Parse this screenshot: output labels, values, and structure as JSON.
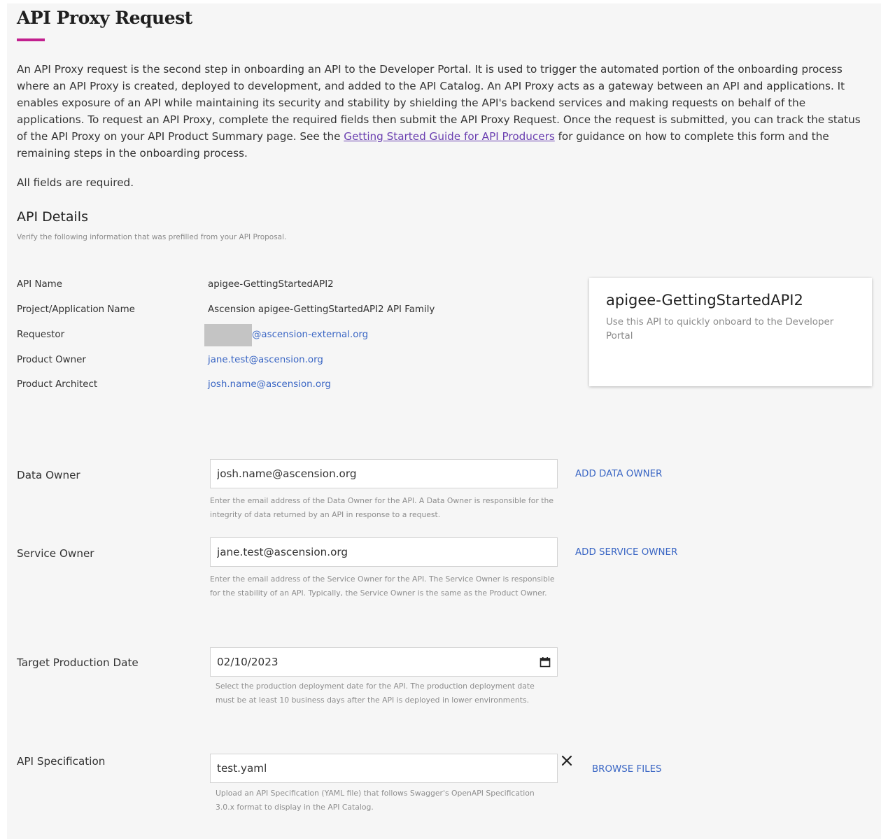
{
  "page": {
    "title": "API Proxy Request",
    "intro_before_link": "An API Proxy request is the second step in onboarding an API to the Developer Portal. It is used to trigger the automated portion of the onboarding process where an API Proxy is created, deployed to development, and added to the API Catalog. An API Proxy acts as a gateway between an API and applications. It enables exposure of an API while maintaining its security and stability by shielding the API's backend services and making requests on behalf of the applications. To request an API Proxy, complete the required fields then submit the API Proxy Request. Once the request is submitted, you can track the status of the API Proxy on your API Product Summary page. See the ",
    "intro_link": "Getting Started Guide for API Producers",
    "intro_after_link": " for guidance on how to complete this form and the remaining steps in the onboarding process.",
    "required_note": "All fields are required."
  },
  "details": {
    "title": "API Details",
    "subtitle": "Verify the following information that was prefilled from your API Proposal.",
    "rows": [
      {
        "label": "API Name",
        "value": "apigee-GettingStartedAPI2"
      },
      {
        "label": "Project/Application Name",
        "value": "Ascension apigee-GettingStartedAPI2 API Family"
      },
      {
        "label": "Requestor",
        "value": "@ascension-external.org"
      },
      {
        "label": "Product Owner",
        "value": "jane.test@ascension.org"
      },
      {
        "label": "Product Architect",
        "value": "josh.name@ascension.org"
      }
    ]
  },
  "card": {
    "title": "apigee-GettingStartedAPI2",
    "description": "Use this API to quickly onboard to the Developer Portal"
  },
  "form": {
    "data_owner": {
      "label": "Data Owner",
      "value": "josh.name@ascension.org",
      "help": "Enter the email address of the Data Owner for the API. A Data Owner is responsible for the integrity of data returned by an API in response to a request.",
      "action": "ADD DATA OWNER"
    },
    "service_owner": {
      "label": "Service Owner",
      "value": "jane.test@ascension.org",
      "help": "Enter the email address of the Service Owner for the API. The Service Owner is responsible for the stability of an API. Typically, the Service Owner is the same as the Product Owner.",
      "action": "ADD SERVICE OWNER"
    },
    "target_date": {
      "label": "Target Production Date",
      "value": "02/10/2023",
      "help": "Select the production deployment date for the API. The production deployment date must be at least 10 business days after the API is deployed in lower environments."
    },
    "api_spec": {
      "label": "API Specification",
      "value": "test.yaml",
      "help": "Upload an API Specification (YAML file) that follows Swagger's OpenAPI Specification 3.0.x format to display in the API Catalog.",
      "action": "BROWSE FILES"
    }
  },
  "icons": {
    "calendar": "calendar-icon",
    "clear": "close-icon"
  },
  "colors": {
    "accent": "#c2208f",
    "link": "#3a66c4",
    "guide_link": "#6a3fb0",
    "page_bg": "#f6f6f6"
  }
}
